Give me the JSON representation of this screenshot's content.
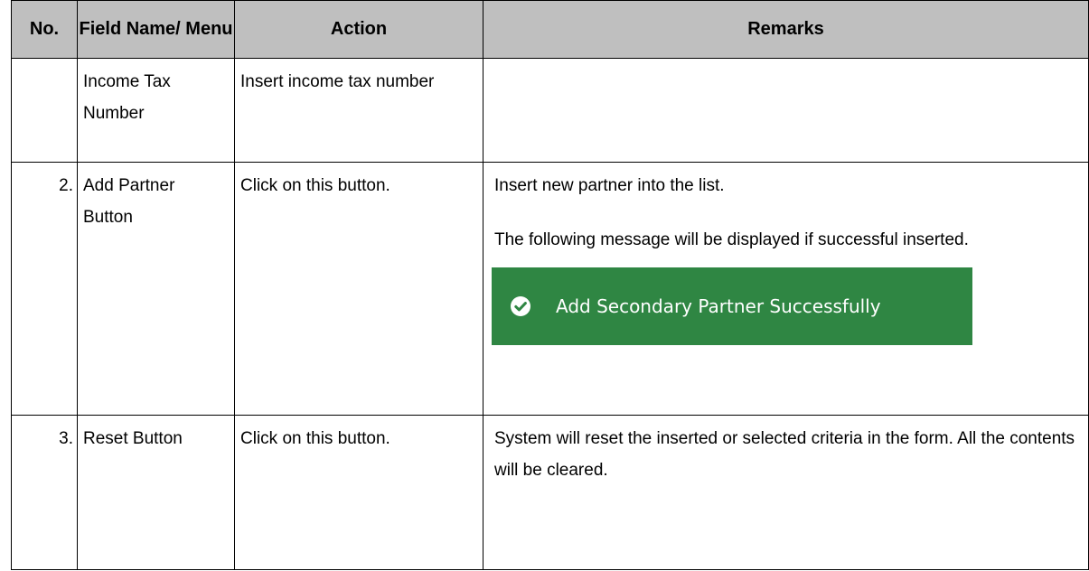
{
  "table": {
    "headers": {
      "no": "No.",
      "field": "Field Name/ Menu",
      "action": "Action",
      "remarks": "Remarks"
    },
    "rows": [
      {
        "no": "",
        "field": "Income Tax Number",
        "action": "Insert income tax number",
        "remarks": []
      },
      {
        "no": "2.",
        "field": "Add Partner Button",
        "action": "Click on this button.",
        "remarks": [
          "Insert new partner into the list.",
          "The following message will be displayed if successful inserted."
        ],
        "banner": {
          "message": "Add Secondary Partner Successfully",
          "icon": "check-circle-icon",
          "color": "#2f8643"
        }
      },
      {
        "no": "3.",
        "field": "Reset Button",
        "action": "Click on this button.",
        "remarks": [
          "System will reset the inserted or selected criteria in the form. All the contents will be cleared."
        ]
      }
    ]
  }
}
